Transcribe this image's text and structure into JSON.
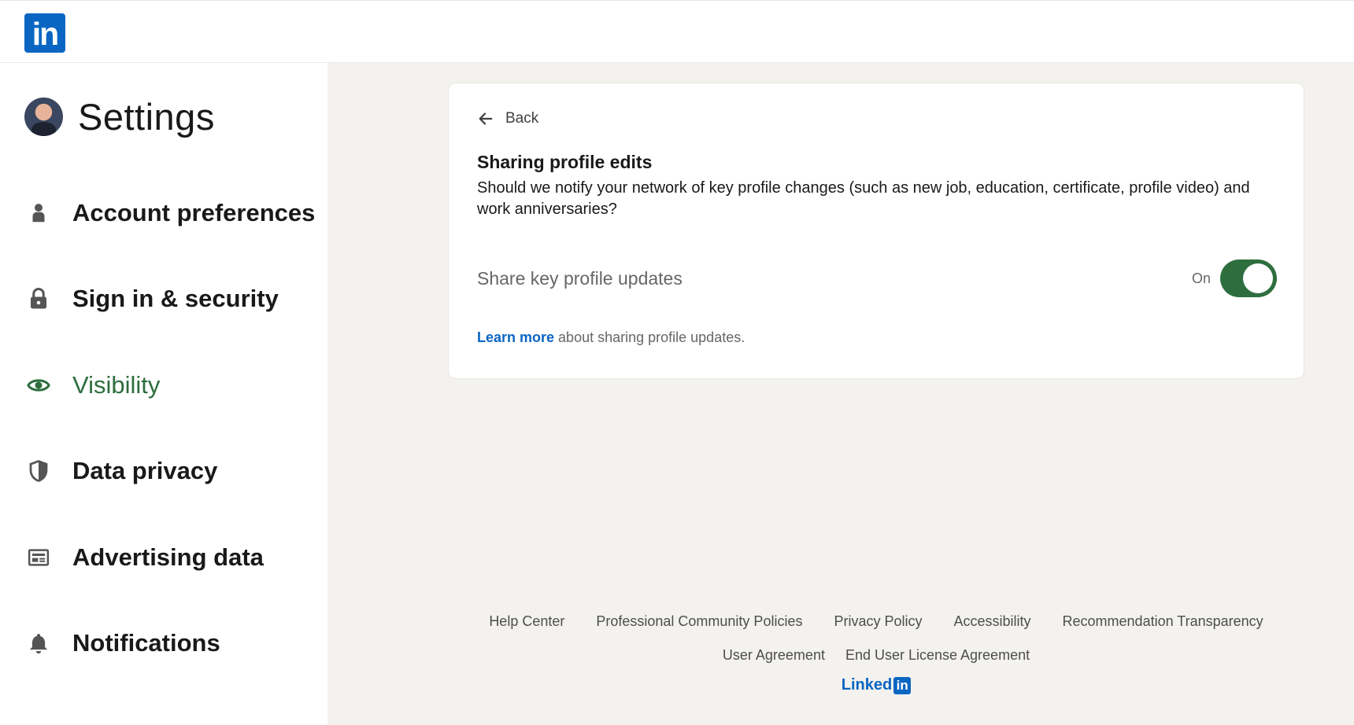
{
  "header": {
    "logo_text": "in"
  },
  "sidebar": {
    "title": "Settings",
    "items": [
      {
        "label": "Account preferences",
        "icon": "person-icon",
        "active": false
      },
      {
        "label": "Sign in & security",
        "icon": "lock-icon",
        "active": false
      },
      {
        "label": "Visibility",
        "icon": "eye-icon",
        "active": true
      },
      {
        "label": "Data privacy",
        "icon": "shield-icon",
        "active": false
      },
      {
        "label": "Advertising data",
        "icon": "newspaper-icon",
        "active": false
      },
      {
        "label": "Notifications",
        "icon": "bell-icon",
        "active": false
      }
    ]
  },
  "card": {
    "back_label": "Back",
    "title": "Sharing profile edits",
    "description": "Should we notify your network of key profile changes (such as new job, education, certificate, profile video) and work anniversaries?",
    "toggle_label": "Share key profile updates",
    "toggle_state": "On",
    "toggle_on": true,
    "learn_more_link": "Learn more",
    "learn_more_text": " about sharing profile updates."
  },
  "footer": {
    "links_row1": [
      "Help Center",
      "Professional Community Policies",
      "Privacy Policy",
      "Accessibility",
      "Recommendation Transparency"
    ],
    "links_row2": [
      "User Agreement",
      "End User License Agreement"
    ],
    "logo_text": "Linked",
    "logo_box": "in"
  },
  "colors": {
    "brand_blue": "#0a66c2",
    "active_green": "#2e6e3e",
    "main_background": "#f3f2ef"
  }
}
